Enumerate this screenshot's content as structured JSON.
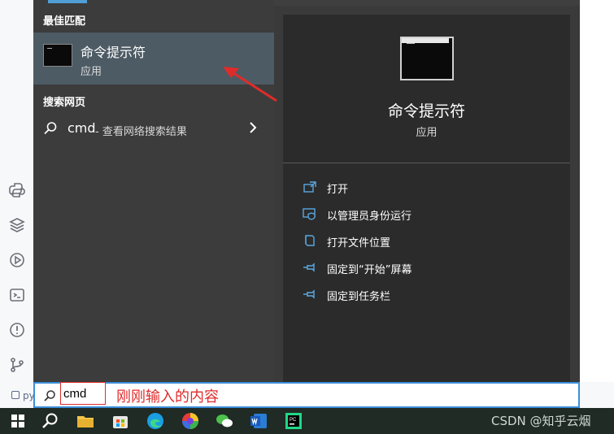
{
  "best_match": {
    "section_title": "最佳匹配",
    "app_name": "命令提示符",
    "app_type": "应用"
  },
  "web_search": {
    "section_title": "搜索网页",
    "query": "cmd",
    "suffix": " - 查看网络搜索结果"
  },
  "detail_panel": {
    "app_name": "命令提示符",
    "app_type": "应用",
    "actions": [
      {
        "label": "打开",
        "icon": "open-icon"
      },
      {
        "label": "以管理员身份运行",
        "icon": "shield-icon"
      },
      {
        "label": "打开文件位置",
        "icon": "folder-icon"
      },
      {
        "label": "固定到“开始”屏幕",
        "icon": "pin-icon"
      },
      {
        "label": "固定到任务栏",
        "icon": "pin-icon"
      }
    ]
  },
  "search_box": {
    "value": "cmd",
    "annotation": "刚刚输入的内容"
  },
  "ide_bottom_text": "py",
  "watermark": "CSDN @知乎云烟",
  "taskbar": {
    "items": [
      "windows-start-icon",
      "search-icon",
      "file-explorer-icon",
      "store-icon",
      "edge-icon",
      "color-app-icon",
      "wechat-icon",
      "word-icon",
      "pycharm-icon"
    ]
  },
  "colors": {
    "accent": "#3b8ed9",
    "annotation_red": "#e02b2b",
    "menu_bg": "#3c3c3c",
    "detail_bg": "#2b2b2b",
    "selected_bg": "#4d5b64"
  }
}
